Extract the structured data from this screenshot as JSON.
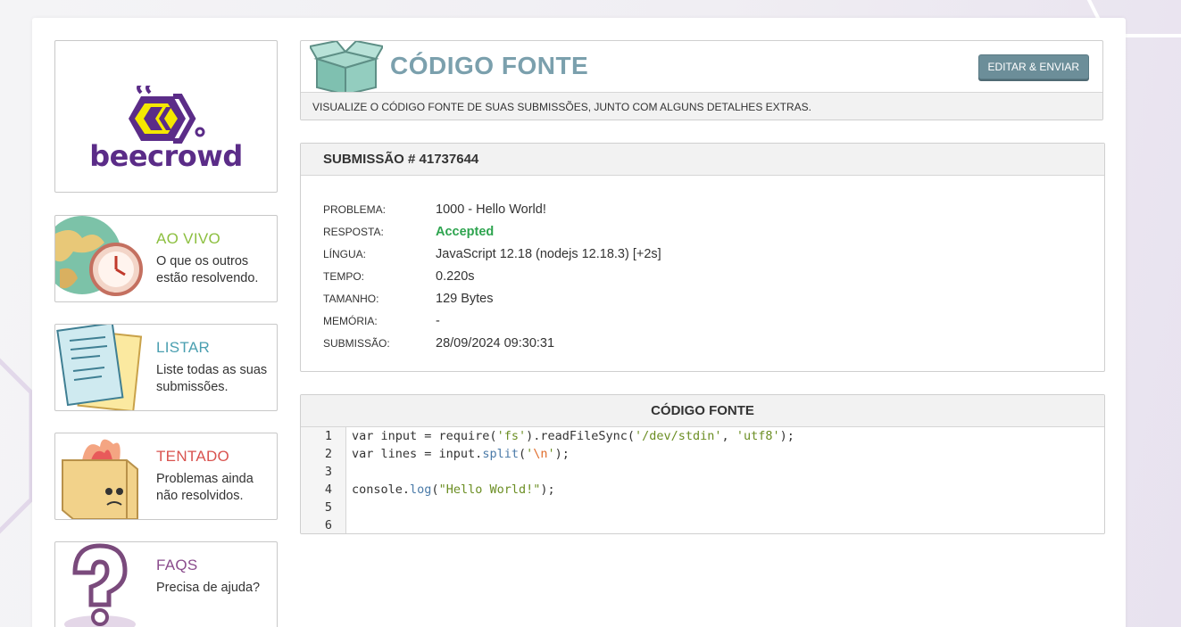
{
  "brand": {
    "name": "beecrowd",
    "purple": "#5b2c88",
    "yellow": "#f5e800"
  },
  "sidebar": {
    "cards": [
      {
        "title": "AO VIVO",
        "desc": "O que os outros estão resolvendo.",
        "color": "#8cbf3f",
        "icon": "globe-clock-icon"
      },
      {
        "title": "LISTAR",
        "desc": "Liste todas as suas submissões.",
        "color": "#4a9fb0",
        "icon": "papers-icon"
      },
      {
        "title": "TENTADO",
        "desc": "Problemas ainda não resolvidos.",
        "color": "#d9534f",
        "icon": "burning-box-icon"
      },
      {
        "title": "FAQS",
        "desc": "Precisa de ajuda?",
        "color": "#8a4b8c",
        "icon": "question-mark-icon"
      }
    ]
  },
  "header": {
    "title": "CÓDIGO FONTE",
    "subtitle": "VISUALIZE O CÓDIGO FONTE DE SUAS SUBMISSÕES, JUNTO COM ALGUNS DETALHES EXTRAS.",
    "edit_button": "EDITAR & ENVIAR",
    "icon": "open-box-icon"
  },
  "submission": {
    "heading": "SUBMISSÃO # 41737644",
    "rows": [
      {
        "label": "PROBLEMA:",
        "value": "1000 - Hello World!"
      },
      {
        "label": "RESPOSTA:",
        "value": "Accepted"
      },
      {
        "label": "LÍNGUA:",
        "value": "JavaScript 12.18 (nodejs 12.18.3) [+2s]"
      },
      {
        "label": "TEMPO:",
        "value": "0.220s"
      },
      {
        "label": "TAMANHO:",
        "value": "129 Bytes"
      },
      {
        "label": "MEMÓRIA:",
        "value": "-"
      },
      {
        "label": "SUBMISSÃO:",
        "value": "28/09/2024 09:30:31"
      }
    ]
  },
  "code": {
    "heading": "CÓDIGO FONTE",
    "line_numbers": [
      "1",
      "2",
      "3",
      "4",
      "5",
      "6"
    ],
    "lines": [
      "var input = require('fs').readFileSync('/dev/stdin', 'utf8');",
      "var lines = input.split('\\n');",
      "",
      "console.log(\"Hello World!\");",
      "",
      ""
    ]
  }
}
